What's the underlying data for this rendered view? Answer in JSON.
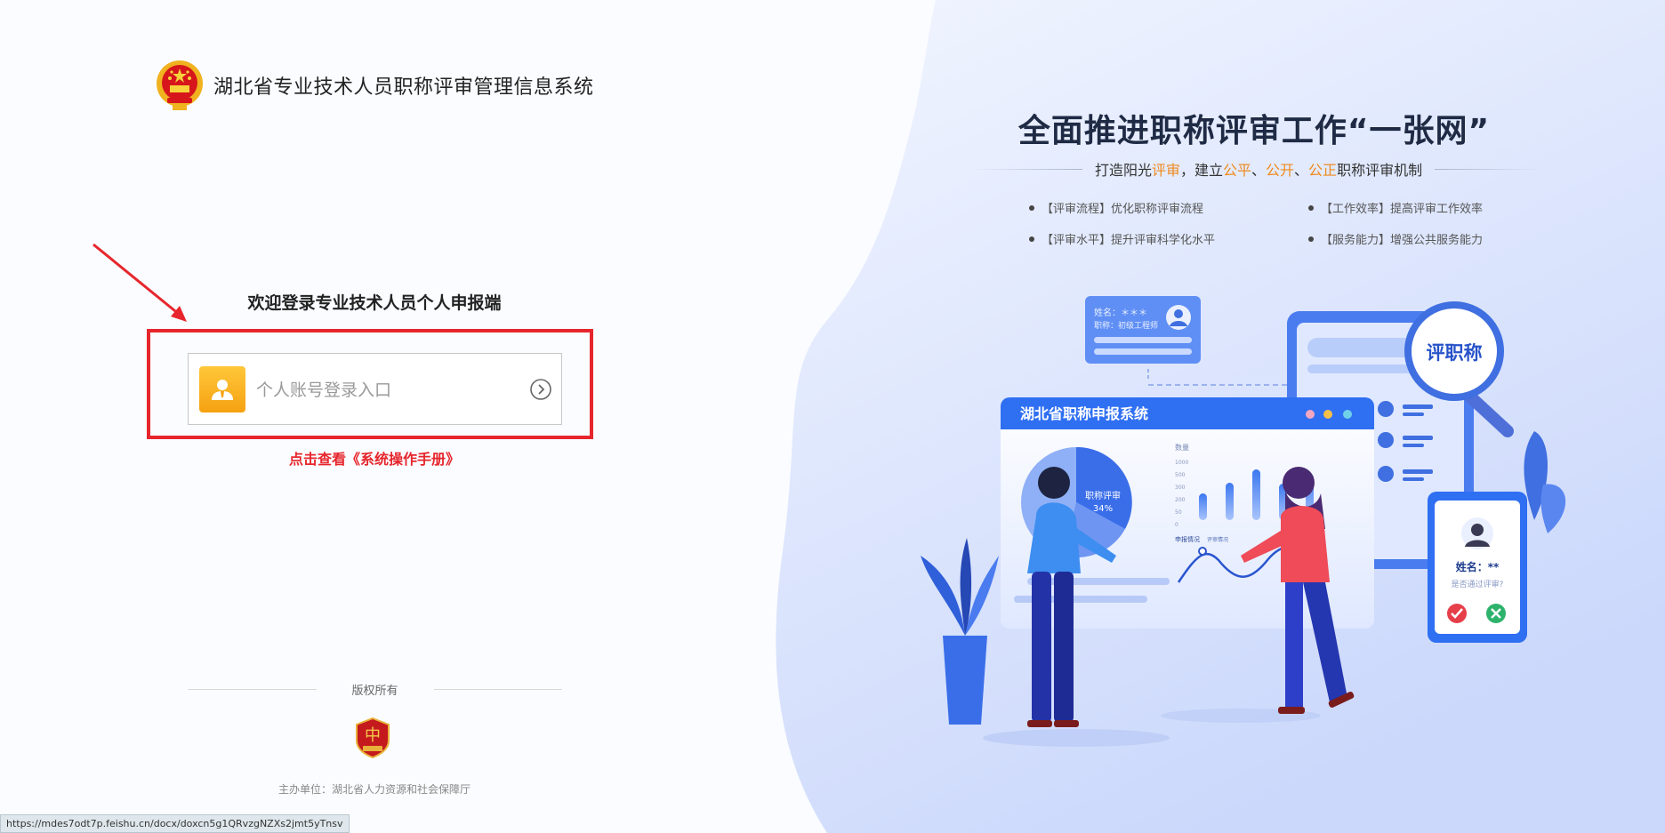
{
  "header": {
    "system_title": "湖北省专业技术人员职称评审管理信息系统"
  },
  "login": {
    "welcome": "欢迎登录专业技术人员个人申报端",
    "entry_label": "个人账号登录入口",
    "manual_link": "点击查看《系统操作手册》"
  },
  "footer": {
    "copyright": "版权所有",
    "sponsor": "主办单位：湖北省人力资源和社会保障厅"
  },
  "status_bar": {
    "url": "https://mdes7odt7p.feishu.cn/docx/doxcn5g1QRvzgNZXs2jmt5yTnsv"
  },
  "promo": {
    "slogan": "全面推进职称评审工作“一张网”",
    "subline": {
      "p1": "打造阳光",
      "h1": "评审",
      "p2": "，建立",
      "h2": "公平",
      "p3": "、",
      "h3": "公开",
      "p4": "、",
      "h4": "公正",
      "p5": "职称评审机制"
    },
    "bullets": [
      "【评审流程】优化职称评审流程",
      "【工作效率】提高评审工作效率",
      "【评审水平】提升评审科学化水平",
      "【服务能力】增强公共服务能力"
    ]
  },
  "illustration": {
    "card_name": "姓名：＊＊＊",
    "card_title": "职称：初级工程师",
    "screen_title": "湖北省职称申报系统",
    "pie_label": "职称评审",
    "pie_percent": "34%",
    "bar_axis_title": "数量",
    "bar_ticks": [
      "1000",
      "500",
      "300",
      "200",
      "50",
      "0"
    ],
    "line_legend_1": "申报情况",
    "line_legend_2": "评审情况",
    "magnifier_label": "评职称",
    "phone_name": "姓名：**",
    "phone_question": "是否通过评审?"
  },
  "colors": {
    "accent_red": "#e6262c",
    "highlight_orange": "#f08a1e",
    "brand_blue": "#2f6ff2"
  }
}
